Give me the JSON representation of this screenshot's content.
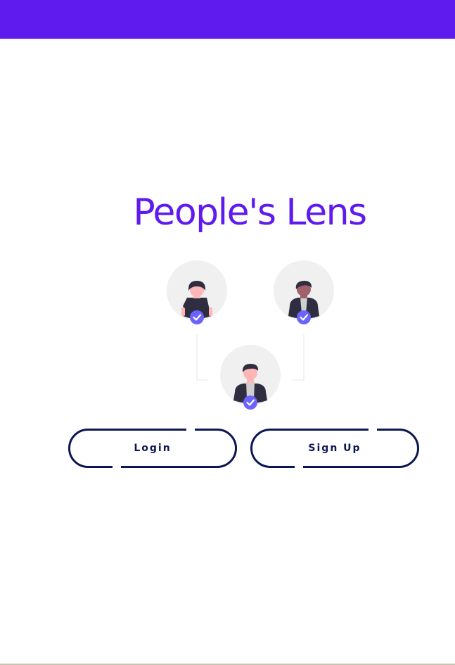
{
  "header": {
    "color": "#5f1aee"
  },
  "main": {
    "title": "People's Lens",
    "illustration": {
      "icons": [
        "person-female-icon",
        "person-male-icon",
        "person-male-icon"
      ],
      "badge_icon": "check-badge-icon"
    }
  },
  "actions": {
    "login_label": "Login",
    "signup_label": "Sign Up"
  },
  "colors": {
    "accent": "#5f1aee",
    "button_border": "#0b1654",
    "badge": "#6c63ff"
  }
}
